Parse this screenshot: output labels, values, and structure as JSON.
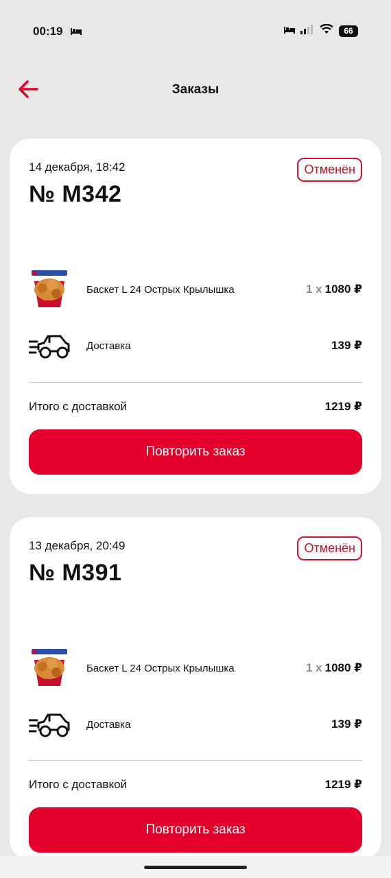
{
  "status_bar": {
    "time": "00:19",
    "battery": "66"
  },
  "header": {
    "title": "Заказы"
  },
  "orders": [
    {
      "date": "14 декабря, 18:42",
      "number": "№ M342",
      "status": "Отменён",
      "item_name": "Баскет L 24 Острых Крылышка",
      "item_qty": "1 x",
      "item_price": "1080 ₽",
      "delivery_label": "Доставка",
      "delivery_price": "139 ₽",
      "total_label": "Итого с доставкой",
      "total_value": "1219 ₽",
      "repeat_label": "Повторить заказ"
    },
    {
      "date": "13 декабря, 20:49",
      "number": "№ M391",
      "status": "Отменён",
      "item_name": "Баскет L 24 Острых Крылышка",
      "item_qty": "1 x",
      "item_price": "1080 ₽",
      "delivery_label": "Доставка",
      "delivery_price": "139 ₽",
      "total_label": "Итого с доставкой",
      "total_value": "1219 ₽",
      "repeat_label": "Повторить заказ"
    }
  ],
  "colors": {
    "accent": "#e4002b",
    "background": "#e9e8e6",
    "card": "#ffffff"
  },
  "icons": [
    "bed-icon",
    "signal-icon",
    "wifi-icon",
    "battery-icon",
    "back-arrow-icon",
    "delivery-car-icon",
    "bucket-product-image"
  ]
}
